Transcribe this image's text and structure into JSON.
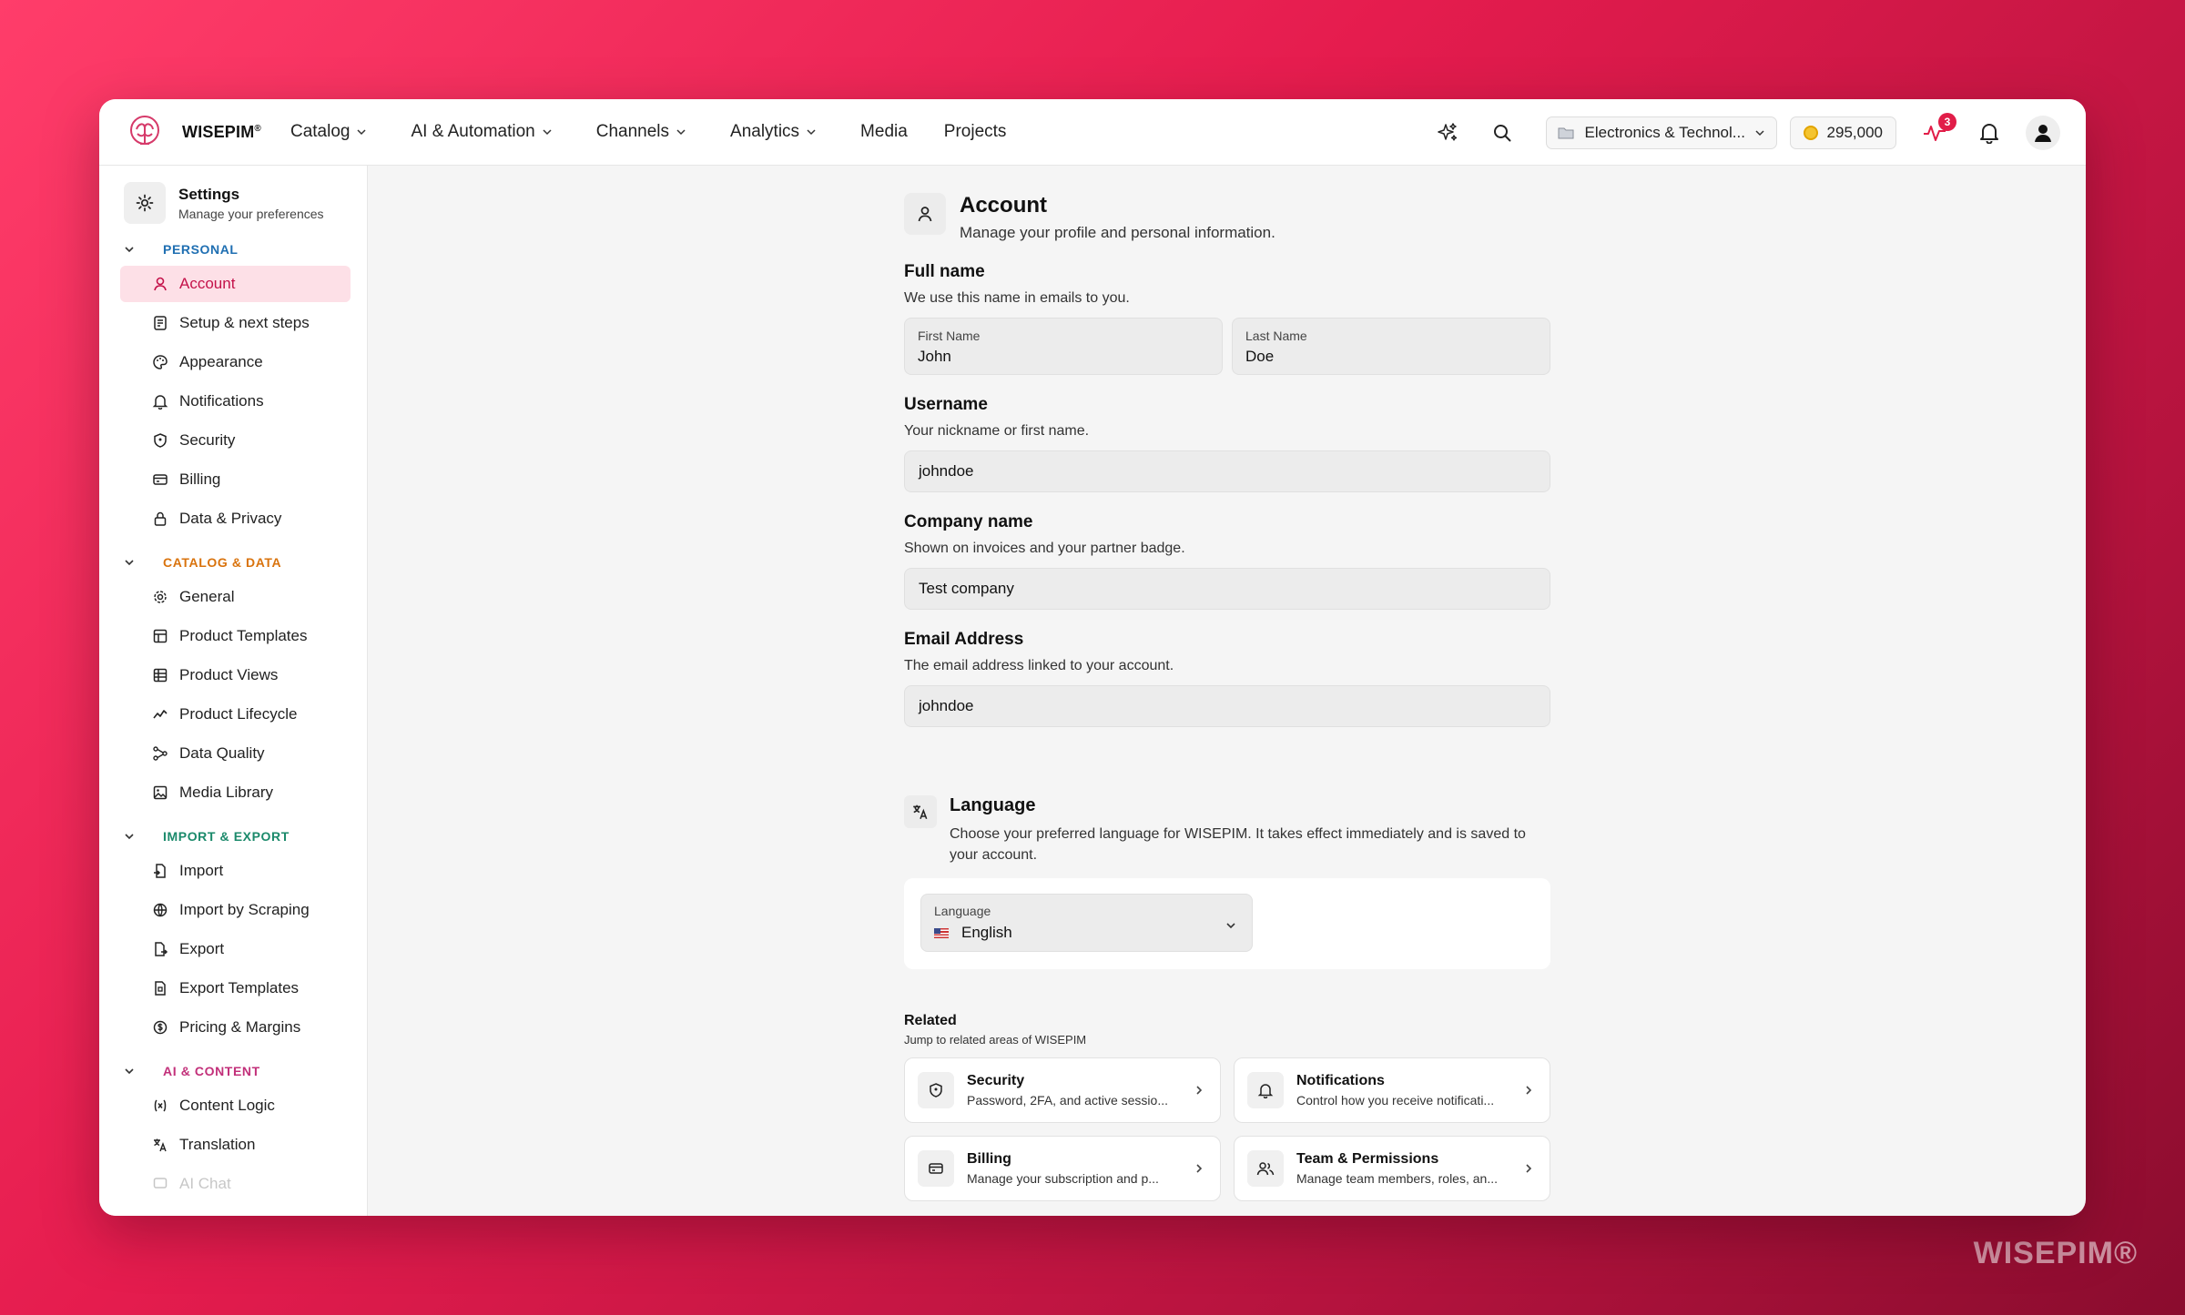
{
  "brand": {
    "name": "WISEPIM",
    "mark": "®"
  },
  "watermark": "WISEPIM®",
  "nav": {
    "catalog": "Catalog",
    "ai": "AI & Automation",
    "channels": "Channels",
    "analytics": "Analytics",
    "media": "Media",
    "projects": "Projects"
  },
  "topbar": {
    "workspace": "Electronics & Technol...",
    "credits": "295,000",
    "activity_badge": "3"
  },
  "sidebar": {
    "title": "Settings",
    "subtitle": "Manage your preferences",
    "groups": {
      "personal": {
        "label": "PERSONAL",
        "color": "#1f6fb2",
        "items": [
          "Account",
          "Setup & next steps",
          "Appearance",
          "Notifications",
          "Security",
          "Billing",
          "Data & Privacy"
        ]
      },
      "catalog": {
        "label": "CATALOG & DATA",
        "color": "#d9730d",
        "items": [
          "General",
          "Product Templates",
          "Product Views",
          "Product Lifecycle",
          "Data Quality",
          "Media Library"
        ]
      },
      "import": {
        "label": "IMPORT & EXPORT",
        "color": "#1b8a6b",
        "items": [
          "Import",
          "Import by Scraping",
          "Export",
          "Export Templates",
          "Pricing & Margins"
        ]
      },
      "ai": {
        "label": "AI & CONTENT",
        "color": "#c2307a",
        "items": [
          "Content Logic",
          "Translation",
          "AI Chat"
        ]
      }
    }
  },
  "account": {
    "title": "Account",
    "subtitle": "Manage your profile and personal information.",
    "fullname": {
      "title": "Full name",
      "desc": "We use this name in emails to you.",
      "first_label": "First Name",
      "first_value": "John",
      "last_label": "Last Name",
      "last_value": "Doe"
    },
    "username": {
      "title": "Username",
      "desc": "Your nickname or first name.",
      "value": "johndoe"
    },
    "company": {
      "title": "Company name",
      "desc": "Shown on invoices and your partner badge.",
      "value": "Test company"
    },
    "email": {
      "title": "Email Address",
      "desc": "The email address linked to your account.",
      "value": "johndoe"
    }
  },
  "language": {
    "title": "Language",
    "desc": "Choose your preferred language for WISEPIM. It takes effect immediately and is saved to your account.",
    "label": "Language",
    "value": "English"
  },
  "related": {
    "title": "Related",
    "subtitle": "Jump to related areas of WISEPIM",
    "cards": [
      {
        "name": "Security",
        "desc": "Password, 2FA, and active sessio..."
      },
      {
        "name": "Notifications",
        "desc": "Control how you receive notificati..."
      },
      {
        "name": "Billing",
        "desc": "Manage your subscription and p..."
      },
      {
        "name": "Team & Permissions",
        "desc": "Manage team members, roles, an..."
      }
    ]
  },
  "colors": {
    "accent": "#c4124a",
    "active_bg": "#fde0e7",
    "background_gradient_start": "#ff3d6a",
    "background_gradient_end": "#8a0c2e"
  }
}
